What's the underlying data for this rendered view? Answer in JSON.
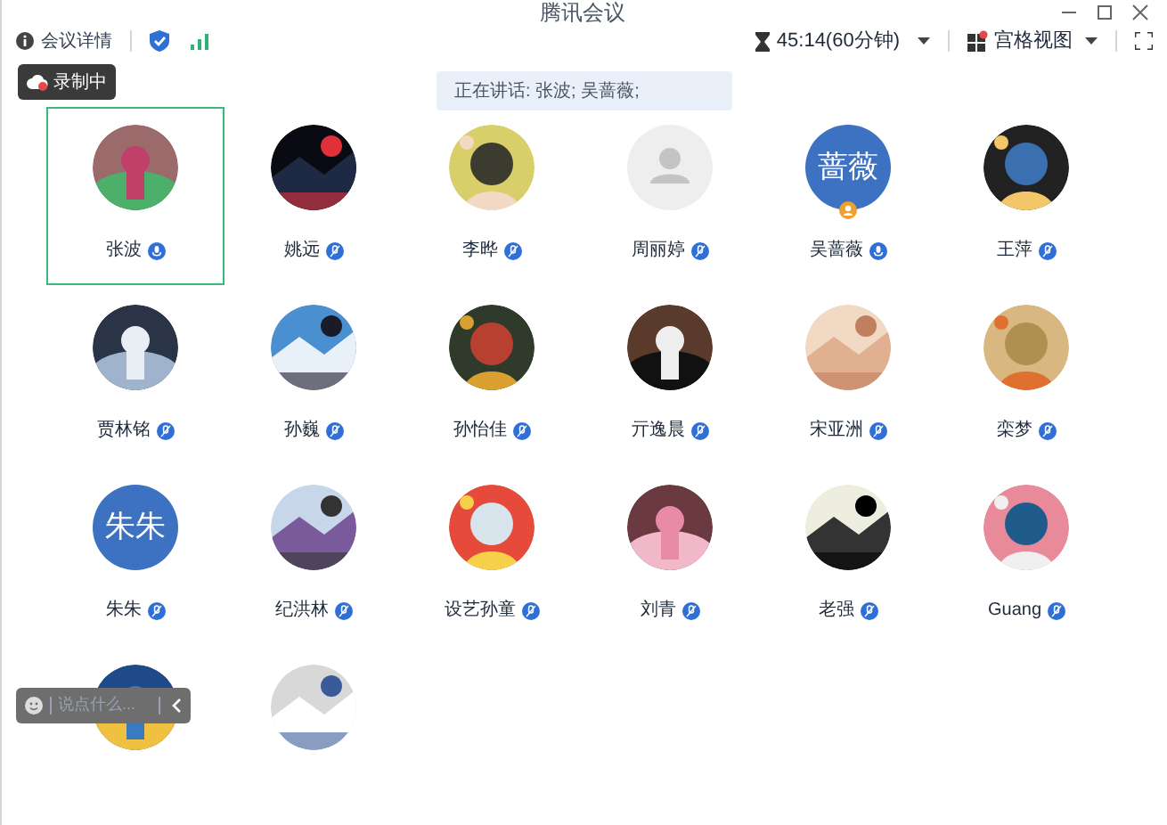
{
  "window": {
    "title": "腾讯会议"
  },
  "toolbar": {
    "details": "会议详情",
    "timer": "45:14(60分钟)",
    "view": "宫格视图",
    "view_notice": true
  },
  "recording": {
    "label": "录制中"
  },
  "speaking_banner": "正在讲话: 张波; 吴蔷薇;",
  "participants": [
    {
      "name": "张波",
      "speaking": true,
      "selected": true
    },
    {
      "name": "姚远",
      "speaking": false,
      "selected": false
    },
    {
      "name": "李晔",
      "speaking": false,
      "selected": false
    },
    {
      "name": "周丽婷",
      "avatar": {
        "kind": "default"
      },
      "speaking": false,
      "selected": false
    },
    {
      "name": "吴蔷薇",
      "avatar": {
        "kind": "text",
        "text": "蔷薇"
      },
      "speaking": true,
      "selected": false,
      "host": true
    },
    {
      "name": "王萍",
      "speaking": false,
      "selected": false
    },
    {
      "name": "贾林铭",
      "speaking": false,
      "selected": false
    },
    {
      "name": "孙巍",
      "speaking": false,
      "selected": false
    },
    {
      "name": "孙怡佳",
      "speaking": false,
      "selected": false
    },
    {
      "name": "亓逸晨",
      "speaking": false,
      "selected": false
    },
    {
      "name": "宋亚洲",
      "speaking": false,
      "selected": false
    },
    {
      "name": "栾梦",
      "speaking": false,
      "selected": false
    },
    {
      "name": "朱朱",
      "avatar": {
        "kind": "text",
        "text": "朱朱"
      },
      "speaking": false,
      "selected": false
    },
    {
      "name": "纪洪林",
      "speaking": false,
      "selected": false
    },
    {
      "name": "设艺孙童",
      "speaking": false,
      "selected": false
    },
    {
      "name": "刘青",
      "speaking": false,
      "selected": false
    },
    {
      "name": "老强",
      "speaking": false,
      "selected": false
    },
    {
      "name": "Guang",
      "speaking": false,
      "selected": false
    },
    {
      "selected": false
    },
    {
      "selected": false
    }
  ],
  "chat": {
    "placeholder": "说点什么..."
  }
}
